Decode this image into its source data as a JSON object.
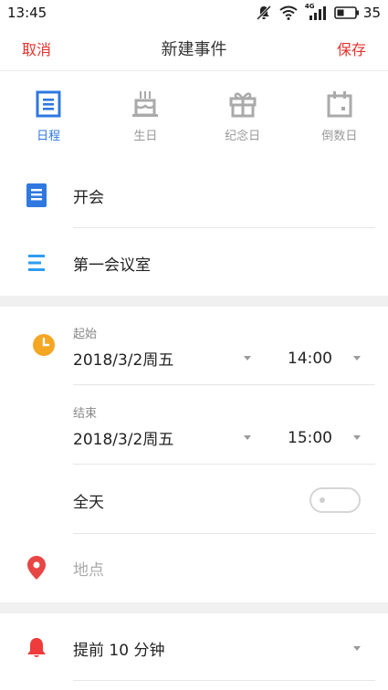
{
  "status_bar": {
    "time": "13:45",
    "battery_level": "35",
    "network_label": "4G"
  },
  "top_bar": {
    "cancel_label": "取消",
    "title": "新建事件",
    "save_label": "保存"
  },
  "type_tabs": [
    {
      "label": "日程",
      "icon": "schedule-icon",
      "active": true
    },
    {
      "label": "生日",
      "icon": "birthday-cake-icon",
      "active": false
    },
    {
      "label": "纪念日",
      "icon": "gift-icon",
      "active": false
    },
    {
      "label": "倒数日",
      "icon": "countdown-calendar-icon",
      "active": false
    }
  ],
  "title_field": {
    "value": "开会",
    "icon": "document-icon"
  },
  "notes_field": {
    "value": "第一会议室",
    "icon": "lines-icon"
  },
  "start": {
    "caption": "起始",
    "date": "2018/3/2周五",
    "time": "14:00",
    "icon": "clock-icon"
  },
  "end": {
    "caption": "结束",
    "date": "2018/3/2周五",
    "time": "15:00"
  },
  "all_day": {
    "label": "全天",
    "enabled": false
  },
  "location": {
    "placeholder": "地点",
    "icon": "location-pin-icon"
  },
  "reminder": {
    "value": "提前 10 分钟",
    "icon": "bell-icon"
  },
  "colors": {
    "accent_red": "#e5322d",
    "accent_blue": "#2f78e0",
    "clock_orange": "#f5a623",
    "pin_red": "#e84545",
    "bell_red": "#ef3b3b"
  }
}
